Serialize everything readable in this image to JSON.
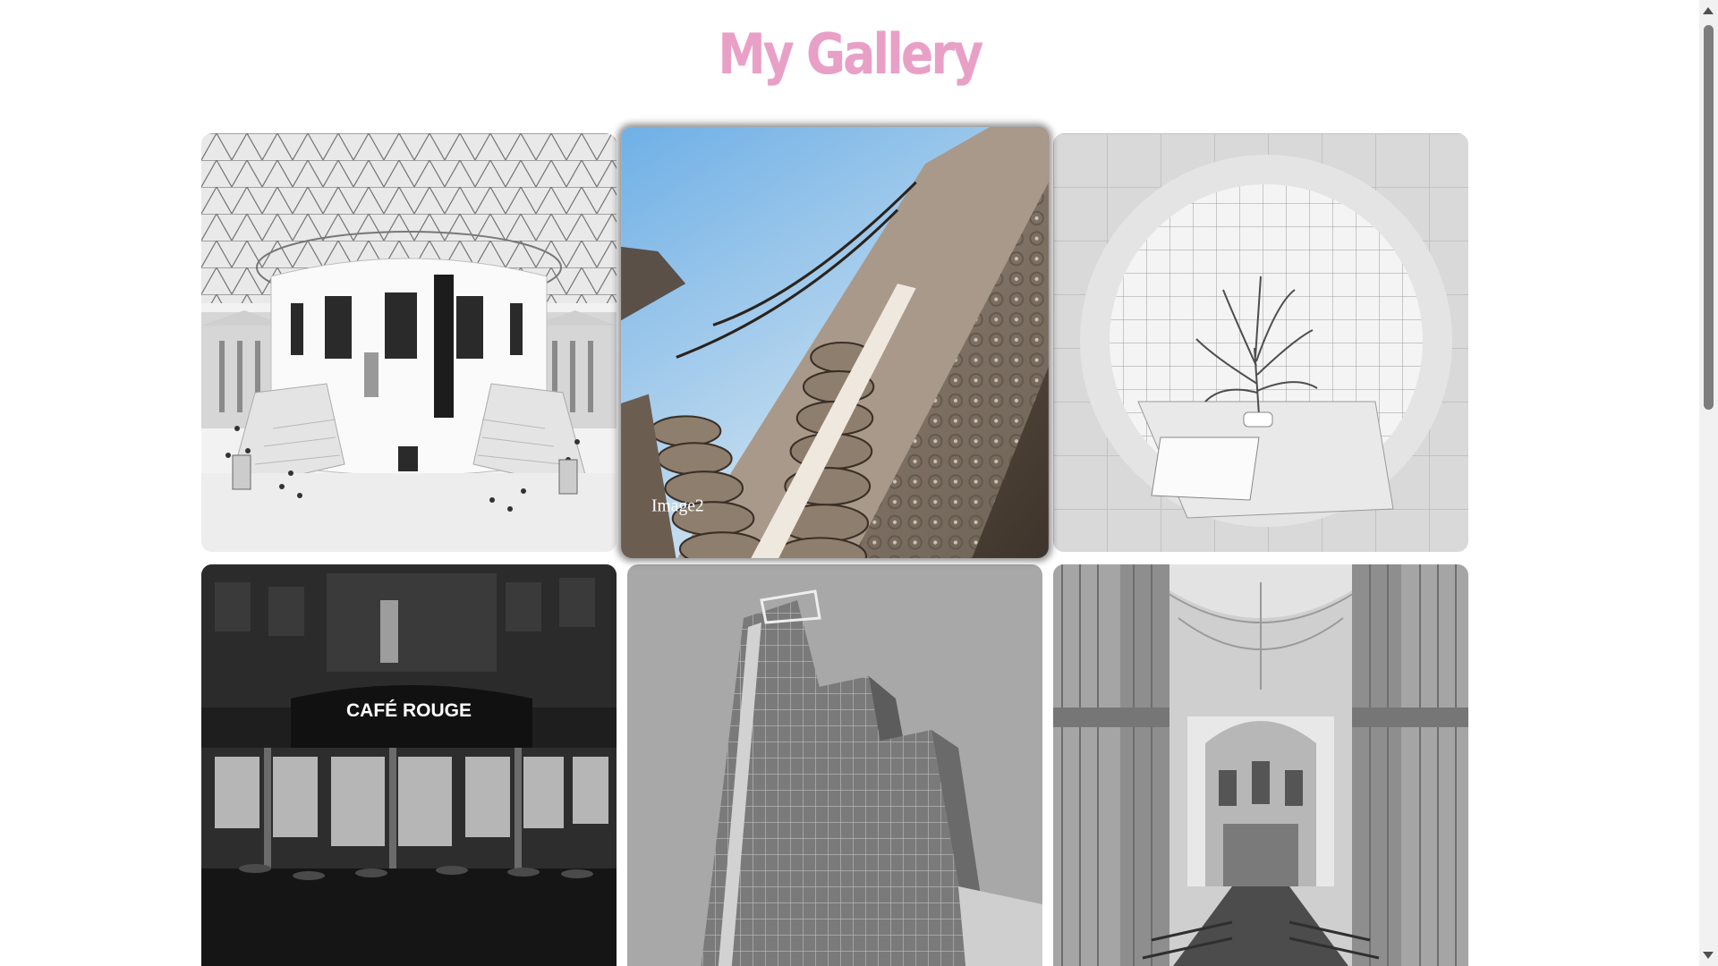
{
  "page": {
    "title": "My Gallery",
    "accent_color": "#e8a0c6"
  },
  "gallery": {
    "items": [
      {
        "name": "gallery-image-1",
        "caption": "",
        "subject": "museum-rotunda"
      },
      {
        "name": "gallery-image-2",
        "caption": "Image2",
        "subject": "ornate-stone-arch",
        "hovered": true
      },
      {
        "name": "gallery-image-3",
        "caption": "",
        "subject": "tiled-room-with-plant"
      },
      {
        "name": "gallery-image-4",
        "caption": "",
        "subject": "cafe-corner-at-night",
        "sign_text": "CAFÉ ROUGE"
      },
      {
        "name": "gallery-image-5",
        "caption": "",
        "subject": "glass-skyscraper"
      },
      {
        "name": "gallery-image-6",
        "caption": "",
        "subject": "cathedral-nave"
      }
    ]
  }
}
